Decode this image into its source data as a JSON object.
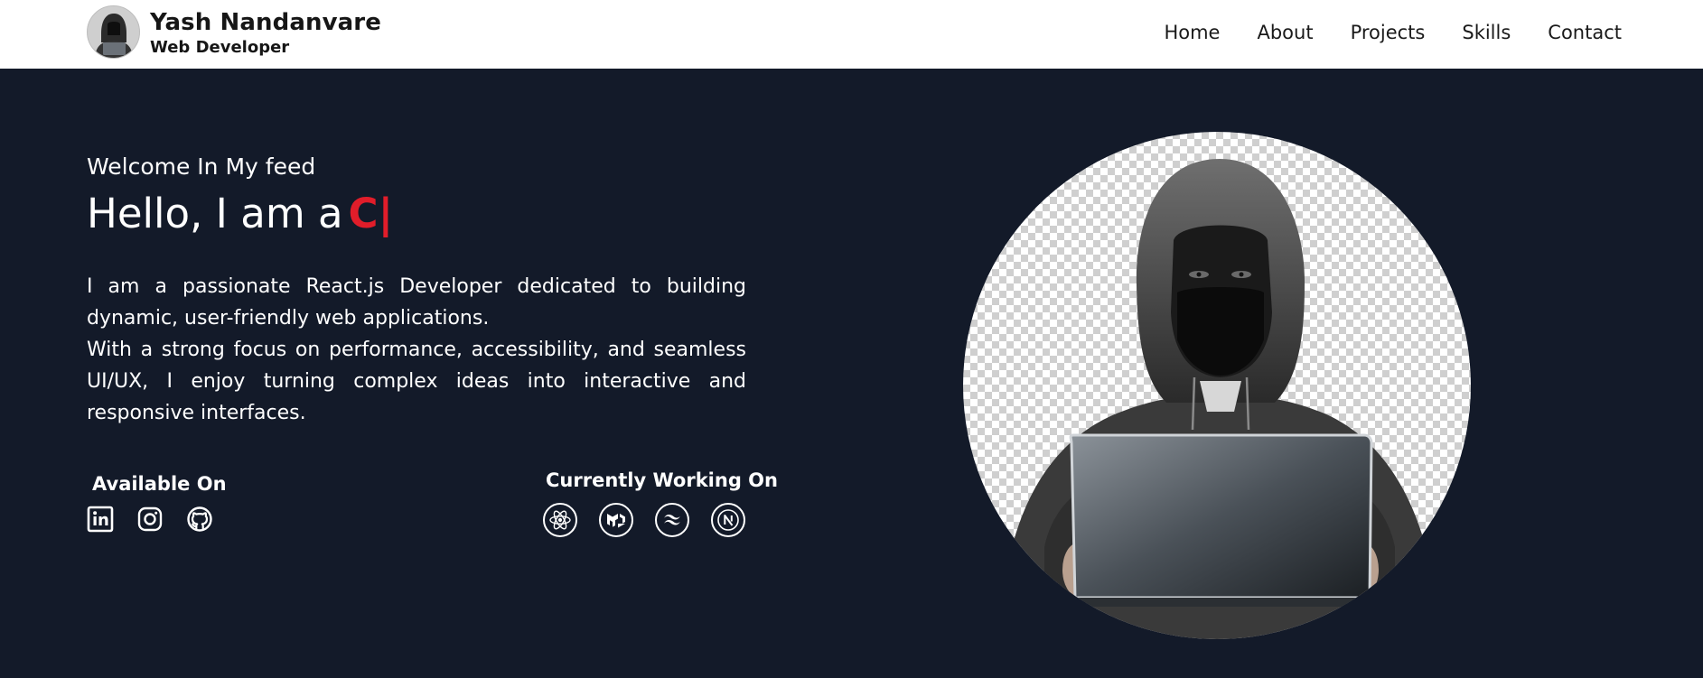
{
  "header": {
    "name": "Yash Nandanvare",
    "role": "Web Developer",
    "avatar_icon": "hooded-hacker-avatar",
    "nav": [
      "Home",
      "About",
      "Projects",
      "Skills",
      "Contact"
    ]
  },
  "hero": {
    "welcome": "Welcome In My feed",
    "hello": "Hello, I am a",
    "typed_text": "C|",
    "description_1": "I am a passionate React.js Developer dedicated to building dynamic, user-friendly web applications.",
    "description_2": "With a strong focus on performance, accessibility, and seamless UI/UX, I enjoy turning complex ideas into interactive and responsive interfaces.",
    "available_title": "Available On",
    "socials": [
      "linkedin-icon",
      "instagram-icon",
      "github-icon"
    ],
    "working_title": "Currently Working On",
    "techs": [
      "react-icon",
      "mui-icon",
      "tailwind-icon",
      "nextjs-icon"
    ],
    "portrait_icon": "hooded-hacker-with-laptop-image"
  },
  "colors": {
    "background": "#131a29",
    "header_bg": "#ffffff",
    "accent_red": "#e11d2a",
    "text_dark": "#161616"
  }
}
